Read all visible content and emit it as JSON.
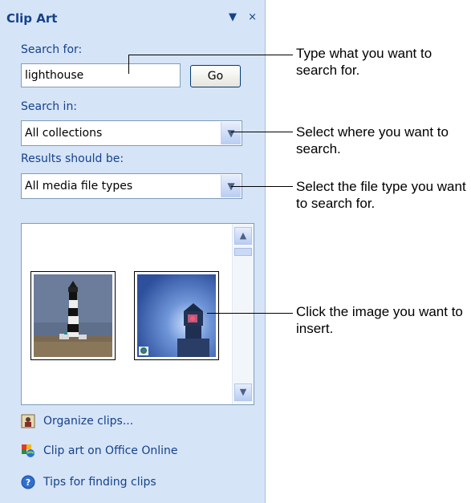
{
  "panel": {
    "title": "Clip Art",
    "dropdown_glyph": "▼",
    "close_glyph": "×"
  },
  "search": {
    "label": "Search for:",
    "value": "lighthouse",
    "go_label": "Go"
  },
  "search_in": {
    "label": "Search in:",
    "selected": "All collections"
  },
  "results_type": {
    "label": "Results should be:",
    "selected": "All media file types"
  },
  "results": {
    "items": [
      {
        "name": "lighthouse-striped"
      },
      {
        "name": "lighthouse-night"
      }
    ]
  },
  "links": {
    "organize": "Organize clips...",
    "online": "Clip art on Office Online",
    "tips": "Tips for finding clips"
  },
  "callouts": {
    "search": "Type what you want to search for.",
    "search_in": "Select where you want to search.",
    "type": "Select the file type you want to search for.",
    "image": "Click the image you want to insert."
  },
  "colors": {
    "panel_bg": "#d6e4f7",
    "heading": "#15428b"
  }
}
